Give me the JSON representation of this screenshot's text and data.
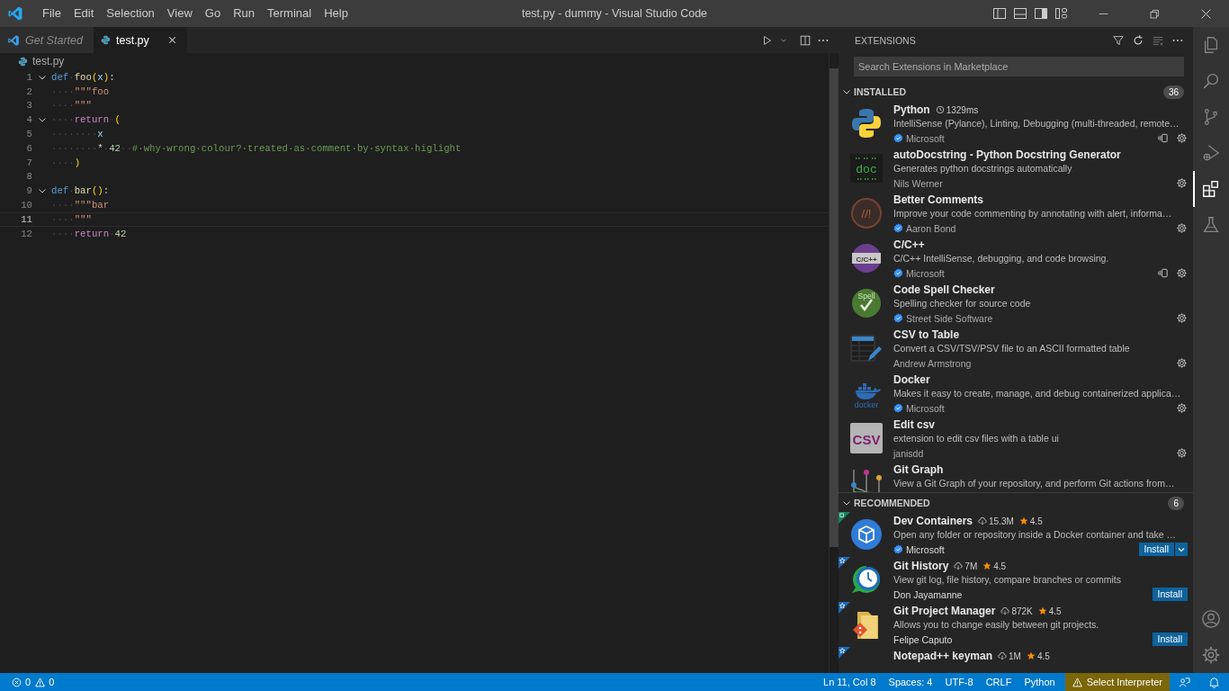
{
  "title_bar": {
    "menu": [
      "File",
      "Edit",
      "Selection",
      "View",
      "Go",
      "Run",
      "Terminal",
      "Help"
    ],
    "title": "test.py - dummy - Visual Studio Code"
  },
  "tabs": [
    {
      "label": "Get Started",
      "selected": false,
      "kind": "welcome"
    },
    {
      "label": "test.py",
      "selected": true,
      "kind": "python",
      "closable": true
    }
  ],
  "breadcrumb": "test.py",
  "code": [
    {
      "number": "1",
      "foldable": true,
      "current": false,
      "tokens": [
        {
          "kind": "keyword",
          "text": "def"
        },
        {
          "kind": "ws",
          "text": "·"
        },
        {
          "kind": "function",
          "text": "foo"
        },
        {
          "kind": "bracket",
          "text": "("
        },
        {
          "kind": "param",
          "text": "x"
        },
        {
          "kind": "bracket",
          "text": ")"
        },
        {
          "kind": "plain",
          "text": ":"
        }
      ]
    },
    {
      "number": "2",
      "foldable": false,
      "current": false,
      "tokens": [
        {
          "kind": "ws",
          "text": "····"
        },
        {
          "kind": "string",
          "text": "\"\"\"foo"
        }
      ]
    },
    {
      "number": "3",
      "foldable": false,
      "current": false,
      "tokens": [
        {
          "kind": "ws",
          "text": "····"
        },
        {
          "kind": "string",
          "text": "\"\"\""
        }
      ]
    },
    {
      "number": "4",
      "foldable": true,
      "current": false,
      "tokens": [
        {
          "kind": "ws",
          "text": "····"
        },
        {
          "kind": "control",
          "text": "return"
        },
        {
          "kind": "ws",
          "text": "·"
        },
        {
          "kind": "bracket",
          "text": "("
        }
      ]
    },
    {
      "number": "5",
      "foldable": false,
      "current": false,
      "tokens": [
        {
          "kind": "ws",
          "text": "········"
        },
        {
          "kind": "param",
          "text": "x"
        }
      ]
    },
    {
      "number": "6",
      "foldable": false,
      "current": false,
      "tokens": [
        {
          "kind": "ws",
          "text": "········"
        },
        {
          "kind": "plain",
          "text": "*"
        },
        {
          "kind": "ws",
          "text": "·"
        },
        {
          "kind": "number",
          "text": "42"
        },
        {
          "kind": "ws",
          "text": "··"
        },
        {
          "kind": "comment",
          "text": "#·why·wrong·colour?·treated·as·comment·by·syntax·higlight"
        }
      ]
    },
    {
      "number": "7",
      "foldable": false,
      "current": false,
      "tokens": [
        {
          "kind": "ws",
          "text": "····"
        },
        {
          "kind": "bracket",
          "text": ")"
        }
      ]
    },
    {
      "number": "8",
      "foldable": false,
      "current": false
    },
    {
      "number": "9",
      "foldable": true,
      "current": false,
      "tokens": [
        {
          "kind": "keyword",
          "text": "def"
        },
        {
          "kind": "ws",
          "text": "·"
        },
        {
          "kind": "function",
          "text": "bar"
        },
        {
          "kind": "bracket",
          "text": "()"
        },
        {
          "kind": "plain",
          "text": ":"
        }
      ]
    },
    {
      "number": "10",
      "foldable": false,
      "current": false,
      "tokens": [
        {
          "kind": "ws",
          "text": "····"
        },
        {
          "kind": "string",
          "text": "\"\"\"bar"
        }
      ]
    },
    {
      "number": "11",
      "foldable": false,
      "current": true,
      "tokens": [
        {
          "kind": "ws",
          "text": "····"
        },
        {
          "kind": "string",
          "text": "\"\"\""
        }
      ]
    },
    {
      "number": "12",
      "foldable": false,
      "current": false,
      "tokens": [
        {
          "kind": "ws",
          "text": "····"
        },
        {
          "kind": "control",
          "text": "return"
        },
        {
          "kind": "ws",
          "text": "·"
        },
        {
          "kind": "number",
          "text": "42"
        }
      ]
    }
  ],
  "extensions": {
    "title": "EXTENSIONS",
    "search": {
      "placeholder": "Search Extensions in Marketplace"
    },
    "sections": [
      {
        "title": "INSTALLED",
        "count": "36",
        "expanded": true,
        "kind": "installed",
        "items": [
          {
            "name": "Python",
            "description": "IntelliSense (Pylance), Linting, Debugging (multi-threaded, remote…",
            "publisher": "Microsoft",
            "verified": true,
            "kind": "python",
            "timing": "1329ms",
            "remote": true
          },
          {
            "name": "autoDocstring - Python Docstring Generator",
            "description": "Generates python docstrings automatically",
            "publisher": "Nils Werner",
            "verified": false,
            "kind": "doc",
            "icon_text": "doc",
            "remote": false
          },
          {
            "name": "Better Comments",
            "description": "Improve your code commenting by annotating with alert, informa…",
            "publisher": "Aaron Bond",
            "verified": true,
            "kind": "comment",
            "icon_text": "//!",
            "remote": false
          },
          {
            "name": "C/C++",
            "description": "C/C++ IntelliSense, debugging, and code browsing.",
            "publisher": "Microsoft",
            "verified": true,
            "kind": "cpp",
            "icon_text": "C/C++",
            "remote": true
          },
          {
            "name": "Code Spell Checker",
            "description": "Spelling checker for source code",
            "publisher": "Street Side Software",
            "verified": true,
            "kind": "spell",
            "icon_text": "Spell",
            "remote": false
          },
          {
            "name": "CSV to Table",
            "description": "Convert a CSV/TSV/PSV file to an ASCII formatted table",
            "publisher": "Andrew Armstrong",
            "verified": false,
            "kind": "table",
            "remote": false
          },
          {
            "name": "Docker",
            "description": "Makes it easy to create, manage, and debug containerized applica…",
            "publisher": "Microsoft",
            "verified": true,
            "kind": "docker",
            "icon_text": "docker",
            "remote": false
          },
          {
            "name": "Edit csv",
            "description": "extension to edit csv files with a table ui",
            "publisher": "janisdd",
            "verified": false,
            "kind": "csv",
            "icon_text": "CSV",
            "remote": false
          },
          {
            "name": "Git Graph",
            "description": "View a Git Graph of your repository, and perform Git actions from…",
            "kind": "gitgraph"
          }
        ]
      },
      {
        "title": "RECOMMENDED",
        "count": "6",
        "expanded": true,
        "kind": "recommended",
        "items": [
          {
            "name": "Dev Containers",
            "description": "Open any folder or repository inside a Docker container and take …",
            "publisher": "Microsoft",
            "verified": true,
            "kind": "container",
            "downloads": "15.3M",
            "rating": "4.5",
            "install": "Install",
            "install_menu": true,
            "ribbon": {
              "kind": "remote"
            }
          },
          {
            "name": "Git History",
            "description": "View git log, file history, compare branches or commits",
            "publisher": "Don Jayamanne",
            "verified": false,
            "kind": "history",
            "downloads": "7M",
            "rating": "4.5",
            "install": "Install",
            "install_menu": false,
            "ribbon": {
              "kind": "star"
            }
          },
          {
            "name": "Git Project Manager",
            "description": "Allows you to change easily between git projects.",
            "publisher": "Felipe Caputo",
            "verified": false,
            "kind": "folder",
            "downloads": "872K",
            "rating": "4.5",
            "install": "Install",
            "install_menu": false,
            "ribbon": {
              "kind": "star"
            }
          },
          {
            "name": "Notepad++ keyman",
            "downloads": "1M",
            "rating": "4.5",
            "ribbon": {
              "kind": "star"
            }
          }
        ]
      }
    ]
  },
  "activity_bar": [
    {
      "kind": "files",
      "selected": false
    },
    {
      "kind": "search",
      "selected": false
    },
    {
      "kind": "source-control",
      "selected": false
    },
    {
      "kind": "run",
      "selected": false
    },
    {
      "kind": "extensions",
      "selected": true
    },
    {
      "kind": "testing",
      "selected": false
    }
  ],
  "status_bar": {
    "errors": "0",
    "warnings": "0",
    "items": [
      "Ln 11, Col 8",
      "Spaces: 4",
      "UTF-8",
      "CRLF",
      "Python"
    ],
    "interpreter": "Select Interpreter"
  }
}
